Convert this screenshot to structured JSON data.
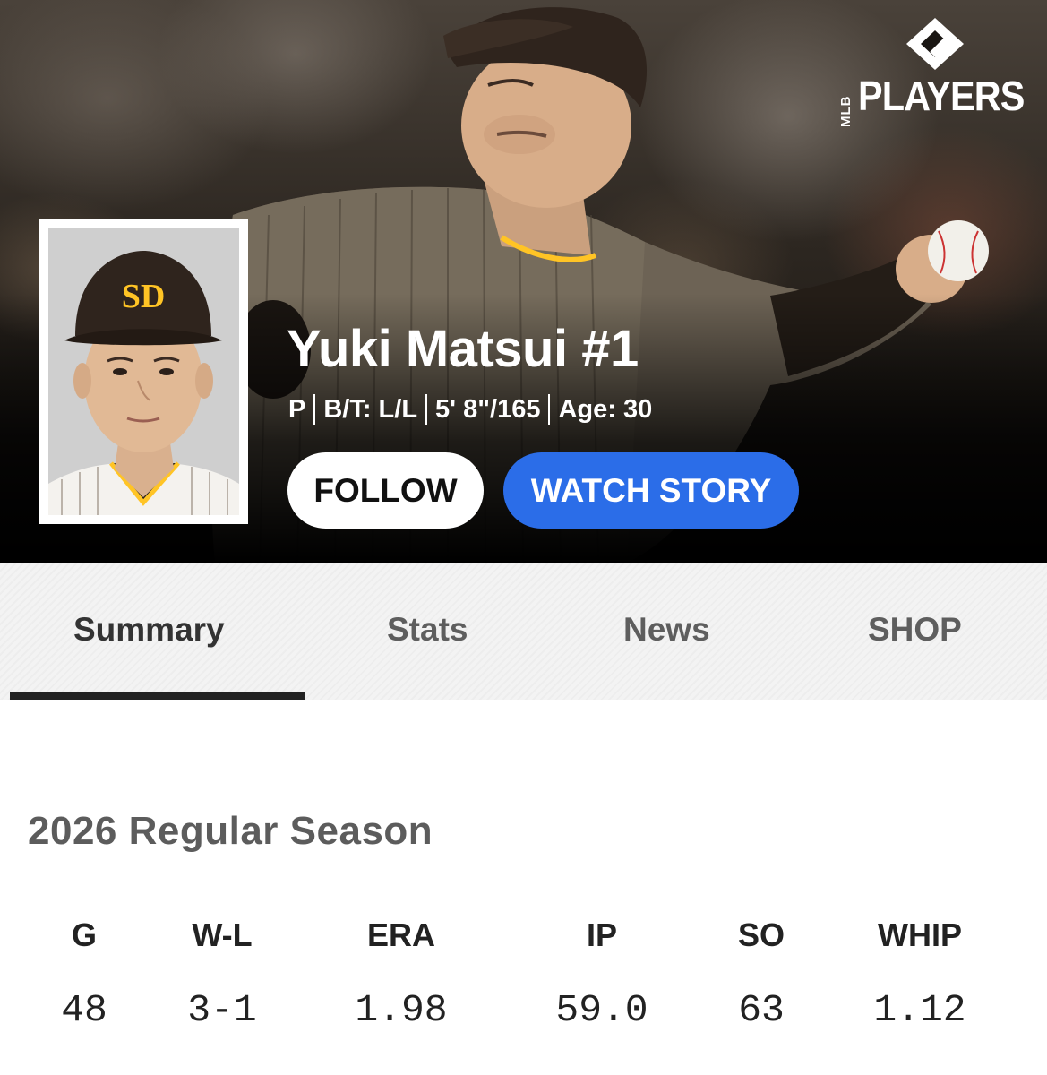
{
  "brand": {
    "league": "MLB",
    "name": "PLAYERS"
  },
  "player": {
    "name": "Yuki Matsui #1",
    "bio": [
      "P",
      "B/T: L/L",
      "5' 8\"/165",
      "Age: 30"
    ]
  },
  "actions": {
    "follow": "FOLLOW",
    "watch_story": "WATCH STORY"
  },
  "tabs": [
    {
      "label": "Summary",
      "active": true
    },
    {
      "label": "Stats",
      "active": false
    },
    {
      "label": "News",
      "active": false
    },
    {
      "label": "SHOP",
      "active": false
    }
  ],
  "season": {
    "title": "2026 Regular Season",
    "stats": [
      {
        "label": "G",
        "value": "48"
      },
      {
        "label": "W-L",
        "value": "3-1"
      },
      {
        "label": "ERA",
        "value": "1.98"
      },
      {
        "label": "IP",
        "value": "59.0"
      },
      {
        "label": "SO",
        "value": "63"
      },
      {
        "label": "WHIP",
        "value": "1.12"
      }
    ]
  },
  "colors": {
    "accent_blue": "#2b6de8",
    "team_brown": "#2f241d",
    "team_gold": "#ffc425"
  }
}
